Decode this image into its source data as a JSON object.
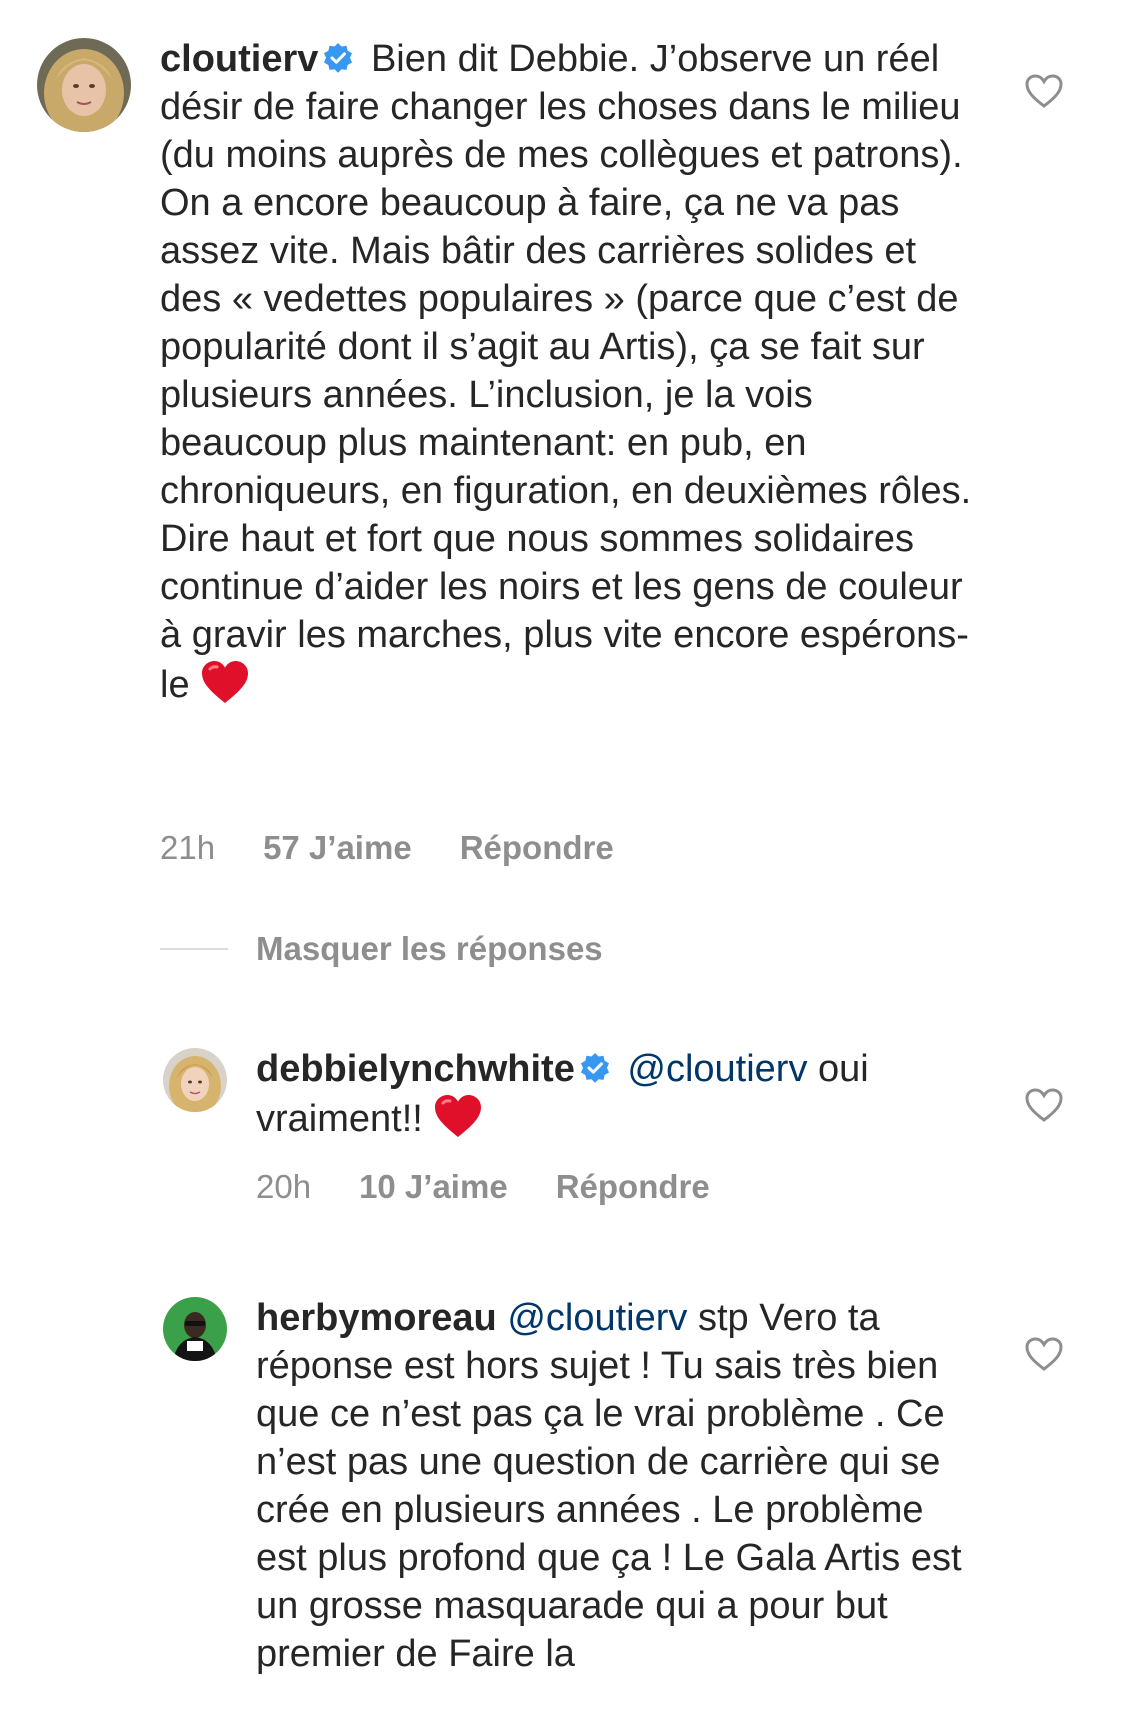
{
  "comments": [
    {
      "username": "cloutierv",
      "verified": true,
      "text": "Bien dit Debbie. J’observe un réel désir de faire changer les choses dans le milieu (du moins auprès de mes collègues et patrons). On a encore beaucoup à faire, ça ne va pas assez vite. Mais bâtir des carrières solides et des « vedettes populaires » (parce que c’est de popularité dont il s’agit au Artis), ça se fait sur plusieurs années. L’inclusion, je la vois beaucoup plus maintenant: en pub, en chroniqueurs, en figuration, en deuxièmes rôles. Dire haut et fort que nous sommes solidaires continue d’aider les noirs et les gens de couleur à gravir les marches, plus vite encore espérons-le",
      "emoji": "red-heart",
      "time": "21h",
      "likes": "57 J’aime",
      "reply": "Répondre"
    },
    {
      "username": "debbielynchwhite",
      "verified": true,
      "mention": "@cloutierv",
      "text": " oui vraiment!!",
      "emoji": "red-heart",
      "time": "20h",
      "likes": "10 J’aime",
      "reply": "Répondre"
    },
    {
      "username": "herbymoreau",
      "verified": false,
      "mention": "@cloutierv",
      "text": " stp Vero ta réponse est hors sujet ! Tu sais très bien que ce n’est pas ça le vrai problème . Ce n’est pas une question de carrière qui se crée en plusieurs années . Le problème est plus profond que ça ! Le Gala Artis est un grosse masquarade qui a pour but  premier de Faire la"
    }
  ],
  "hide_replies": "Masquer les réponses",
  "colors": {
    "text": "#262626",
    "meta": "#8e8e8e",
    "mention": "#00376b",
    "verified": "#3897f0",
    "heart": "#e0102a"
  }
}
